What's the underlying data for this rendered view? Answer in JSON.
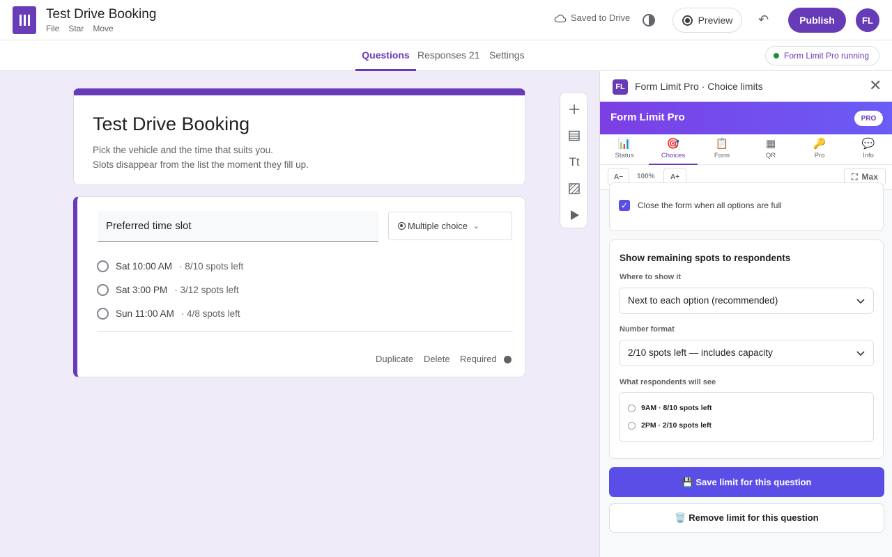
{
  "header": {
    "doc_title": "Test Drive Booking",
    "menu": [
      "File",
      "Star",
      "Move"
    ],
    "saved_status": "Saved to Drive",
    "preview_label": "Preview",
    "publish_label": "Publish",
    "avatar_initials": "FL"
  },
  "tabs": [
    {
      "label": "Questions"
    },
    {
      "label": "Responses 21"
    },
    {
      "label": "Settings"
    }
  ],
  "extension_chip": "Form Limit Pro running",
  "form": {
    "title": "Test Drive Booking",
    "description_line1": "Pick the vehicle and the time that suits you.",
    "description_line2": "Slots disappear from the list the moment they fill up.",
    "question": {
      "title": "Preferred time slot",
      "type": "Multiple choice",
      "options": [
        {
          "label": "Sat 10:00 AM",
          "spots": "· 8/10 spots left"
        },
        {
          "label": "Sat 3:00 PM",
          "spots": "· 3/12 spots left"
        },
        {
          "label": "Sun 11:00 AM",
          "spots": "· 4/8 spots left"
        }
      ],
      "footer": {
        "duplicate": "Duplicate",
        "delete": "Delete",
        "required": "Required"
      }
    }
  },
  "toolbar": {
    "add_icon": "plus-icon",
    "import_icon": "import-questions-icon",
    "title_icon": "Tt",
    "image_icon": "image-icon",
    "video_icon": "video-icon"
  },
  "panel": {
    "badge": "FL",
    "title": "Form Limit Pro · Choice limits",
    "brand": "Form Limit Pro",
    "pro_badge": "PRO",
    "tabs": [
      {
        "label": "Status",
        "icon": "📊"
      },
      {
        "label": "Choices",
        "icon": "🎯"
      },
      {
        "label": "Form",
        "icon": "📋"
      },
      {
        "label": "QR",
        "icon": "▦"
      },
      {
        "label": "Pro",
        "icon": "🔑"
      },
      {
        "label": "Info",
        "icon": "💬"
      }
    ],
    "zoom": {
      "decrease": "A−",
      "level": "100%",
      "increase": "A+",
      "max": "Max"
    },
    "close_when_full_label": "Close the form when all options are full",
    "close_when_full_checked": true,
    "remaining_section": {
      "title": "Show remaining spots to respondents",
      "where_label": "Where to show it",
      "where_value": "Next to each option (recommended)",
      "format_label": "Number format",
      "format_value": "2/10 spots left — includes capacity",
      "preview_label": "What respondents will see",
      "preview_options": [
        "9AM · 8/10 spots left",
        "2PM · 2/10 spots left"
      ]
    },
    "save_label": "💾 Save limit for this question",
    "remove_label": "🗑️ Remove limit for this question"
  },
  "colors": {
    "brand_purple": "#673ab7",
    "panel_accent": "#5b4ee6",
    "background": "#f0ebf8"
  }
}
